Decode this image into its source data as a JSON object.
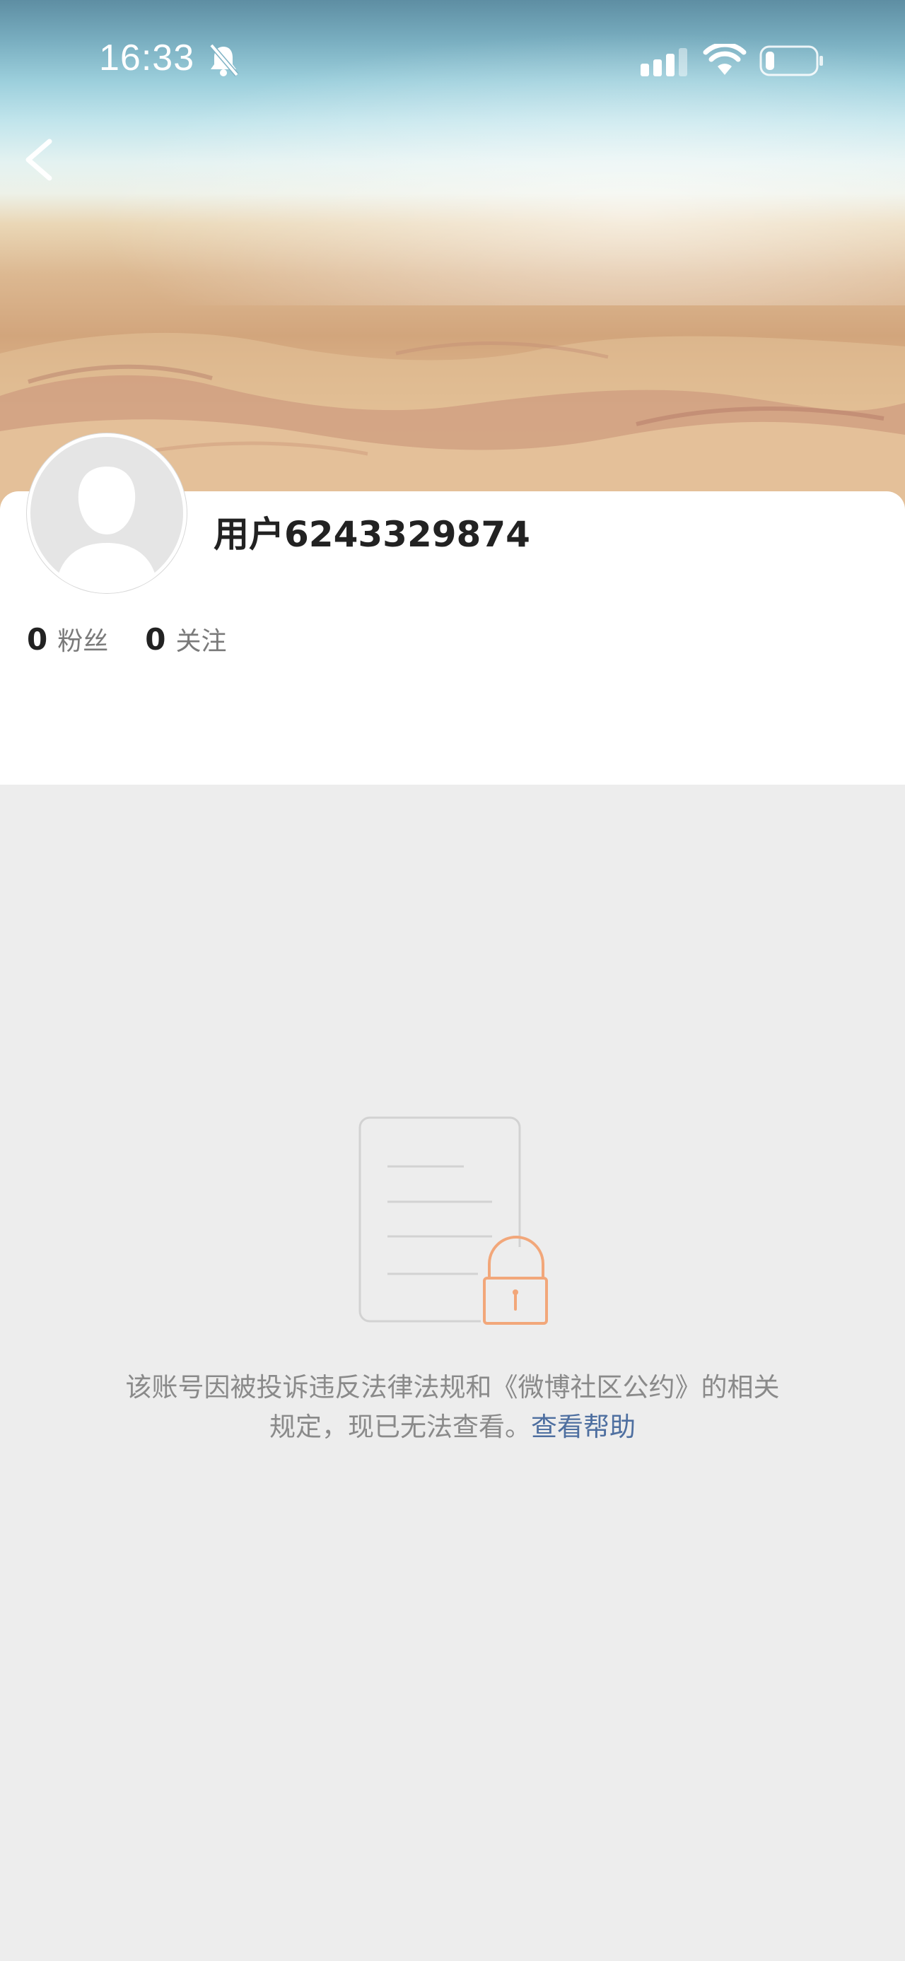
{
  "status_bar": {
    "time": "16:33",
    "icons": [
      "bell-muted-icon",
      "cellular-signal-icon",
      "wifi-icon",
      "battery-icon"
    ]
  },
  "nav": {
    "back_icon": "chevron-left-icon"
  },
  "profile": {
    "username": "用户6243329874",
    "followers_count": "0",
    "followers_label": "粉丝",
    "following_count": "0",
    "following_label": "关注"
  },
  "notice": {
    "illustration_icon": "locked-document-icon",
    "line1": "该账号因被投诉违反法律法规和《微博社区公约》的相关",
    "line2": "规定，现已无法查看。",
    "help_link": "查看帮助"
  },
  "colors": {
    "page_background": "#ededed",
    "card_background": "#ffffff",
    "link": "#4e6fa0",
    "lock_accent": "#f2a77a"
  }
}
